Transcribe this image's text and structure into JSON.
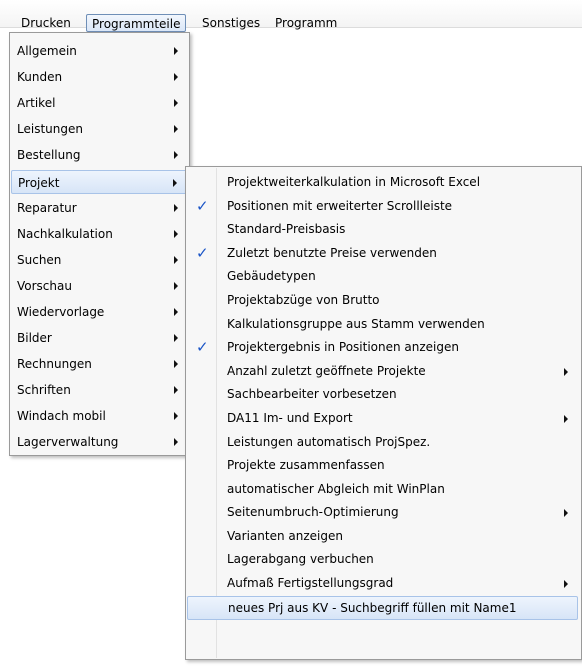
{
  "menubar": {
    "items": [
      {
        "label": "Drucken"
      },
      {
        "label": "Programmteile"
      },
      {
        "label": "Sonstiges"
      },
      {
        "label": "Programm"
      }
    ]
  },
  "menu1": {
    "items": [
      {
        "label": "Allgemein"
      },
      {
        "label": "Kunden"
      },
      {
        "label": "Artikel"
      },
      {
        "label": "Leistungen"
      },
      {
        "label": "Bestellung"
      },
      {
        "label": "Projekt"
      },
      {
        "label": "Reparatur"
      },
      {
        "label": "Nachkalkulation"
      },
      {
        "label": "Suchen"
      },
      {
        "label": "Vorschau"
      },
      {
        "label": "Wiedervorlage"
      },
      {
        "label": "Bilder"
      },
      {
        "label": "Rechnungen"
      },
      {
        "label": "Schriften"
      },
      {
        "label": "Windach mobil"
      },
      {
        "label": "Lagerverwaltung"
      }
    ]
  },
  "menu2": {
    "items": [
      {
        "label": "Projektweiterkalkulation in Microsoft Excel"
      },
      {
        "label": "Positionen mit erweiterter Scrollleiste"
      },
      {
        "label": "Standard-Preisbasis"
      },
      {
        "label": "Zuletzt benutzte Preise verwenden"
      },
      {
        "label": "Gebäudetypen"
      },
      {
        "label": "Projektabzüge von Brutto"
      },
      {
        "label": "Kalkulationsgruppe aus Stamm verwenden"
      },
      {
        "label": "Projektergebnis in Positionen anzeigen"
      },
      {
        "label": "Anzahl zuletzt geöffnete Projekte"
      },
      {
        "label": "Sachbearbeiter vorbesetzen"
      },
      {
        "label": "DA11 Im- und Export"
      },
      {
        "label": "Leistungen automatisch ProjSpez."
      },
      {
        "label": "Projekte zusammenfassen"
      },
      {
        "label": "automatischer Abgleich mit WinPlan"
      },
      {
        "label": "Seitenumbruch-Optimierung"
      },
      {
        "label": "Varianten anzeigen"
      },
      {
        "label": "Lagerabgang verbuchen"
      },
      {
        "label": "Aufmaß Fertigstellungsgrad"
      },
      {
        "label": "neues Prj aus KV - Suchbegriff füllen mit Name1"
      }
    ],
    "check_glyph": "✓"
  },
  "colors": {
    "highlight": "#d7e5f7",
    "highlight_border": "#a8c3e8",
    "check": "#1c56c7"
  }
}
